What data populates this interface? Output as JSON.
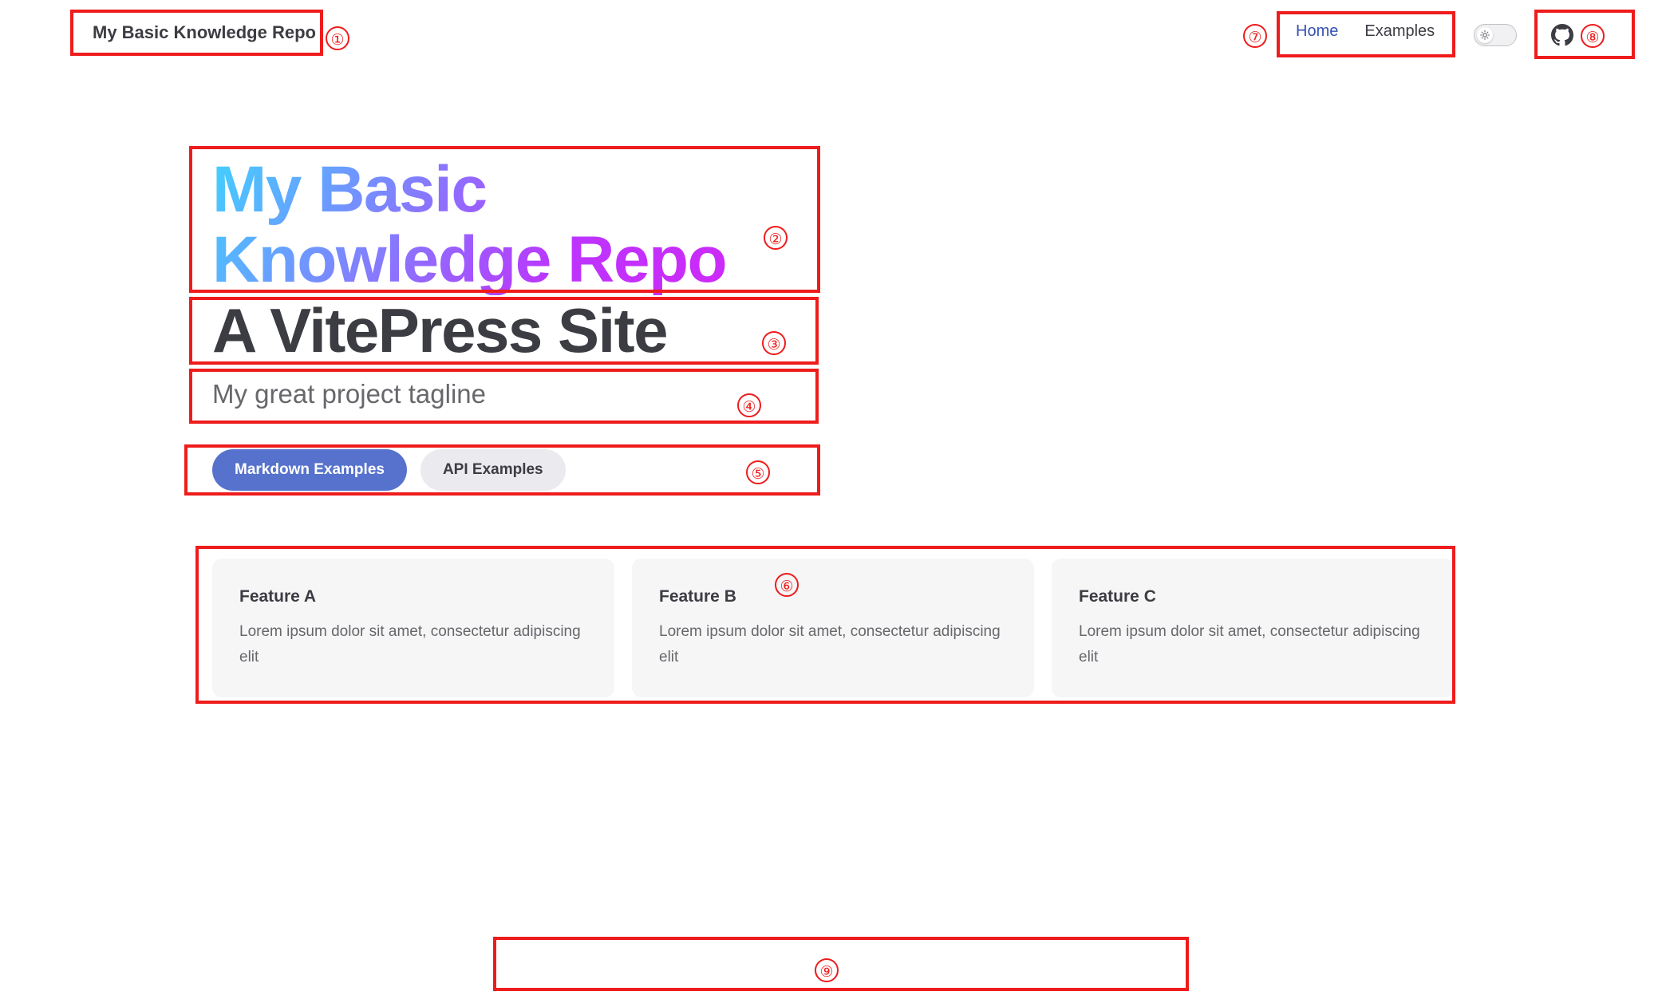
{
  "nav": {
    "site_title": "My Basic Knowledge Repo",
    "links": [
      {
        "label": "Home",
        "active": true
      },
      {
        "label": "Examples",
        "active": false
      }
    ],
    "theme_toggle_icon": "sun-icon",
    "social_icon": "github-icon"
  },
  "hero": {
    "name": "My Basic Knowledge Repo",
    "text": "A VitePress Site",
    "tagline": "My great project tagline",
    "actions": [
      {
        "label": "Markdown Examples",
        "theme": "brand"
      },
      {
        "label": "API Examples",
        "theme": "alt"
      }
    ]
  },
  "features": [
    {
      "title": "Feature A",
      "details": "Lorem ipsum dolor sit amet, consectetur adipiscing elit"
    },
    {
      "title": "Feature B",
      "details": "Lorem ipsum dolor sit amet, consectetur adipiscing elit"
    },
    {
      "title": "Feature C",
      "details": "Lorem ipsum dolor sit amet, consectetur adipiscing elit"
    }
  ],
  "annotations": [
    "①",
    "②",
    "③",
    "④",
    "⑤",
    "⑥",
    "⑦",
    "⑧",
    "⑨"
  ],
  "colors": {
    "annotation": "#ee1c1c",
    "brand": "#5672cd",
    "active_link": "#3451b2",
    "gradient_start": "#41d1ff",
    "gradient_end": "#bd34fe"
  }
}
